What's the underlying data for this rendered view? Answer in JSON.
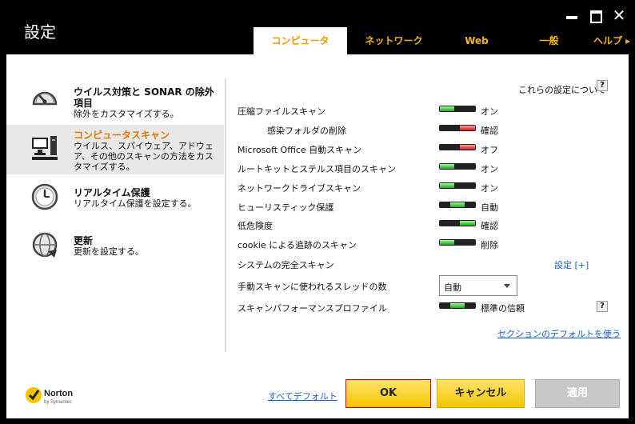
{
  "window": {
    "title": "設定"
  },
  "tabs": [
    "コンピュータ",
    "ネットワーク",
    "Web",
    "一般",
    "ヘルプ ▸"
  ],
  "sidebar": [
    {
      "title": "ウイルス対策と SONAR の除外項目",
      "desc": "除外をカスタマイズする。",
      "icon": "speedometer-icon"
    },
    {
      "title": "コンピュータスキャン",
      "desc": "ウイルス、スパイウェア、アドウェア、その他のスキャンの方法をカスタマイズする。",
      "icon": "computer-icon"
    },
    {
      "title": "リアルタイム保護",
      "desc": "リアルタイム保護を設定する。",
      "icon": "clock-icon"
    },
    {
      "title": "更新",
      "desc": "更新を設定する。",
      "icon": "globe-update-icon"
    }
  ],
  "main": {
    "about_label": "これらの設定について",
    "help_glyph": "?",
    "rows": [
      {
        "label": "圧縮ファイルスキャン",
        "value": "オン"
      },
      {
        "label": "感染フォルダの削除",
        "value": "確認"
      },
      {
        "label": "Microsoft Office 自動スキャン",
        "value": "オフ"
      },
      {
        "label": "ルートキットとステルス項目のスキャン",
        "value": "オン"
      },
      {
        "label": "ネットワークドライブスキャン",
        "value": "オン"
      },
      {
        "label": "ヒューリスティック保護",
        "value": "自動"
      },
      {
        "label": "低危険度",
        "value": "確認"
      },
      {
        "label": "cookie による追跡のスキャン",
        "value": "削除"
      }
    ],
    "full_scan": {
      "label": "システムの完全スキャン",
      "link": "設定 [+]"
    },
    "threads": {
      "label": "手動スキャンに使われるスレッドの数",
      "value": "自動"
    },
    "perf": {
      "label": "スキャンパフォーマンスプロファイル",
      "value": "標準の信頼",
      "help_glyph": "?"
    },
    "defaults_link": "セクションのデフォルトを使う"
  },
  "footer": {
    "logo_text": "Norton",
    "logo_sub": "by Symantec",
    "all_defaults": "すべてデフォルト",
    "ok": "OK",
    "cancel": "キャンセル",
    "apply": "適用"
  },
  "colors": {
    "accent": "#f5b800",
    "active_text": "#e07800",
    "link": "#1a5fd0",
    "on": "#1ea51e",
    "off": "#d21b1b"
  }
}
